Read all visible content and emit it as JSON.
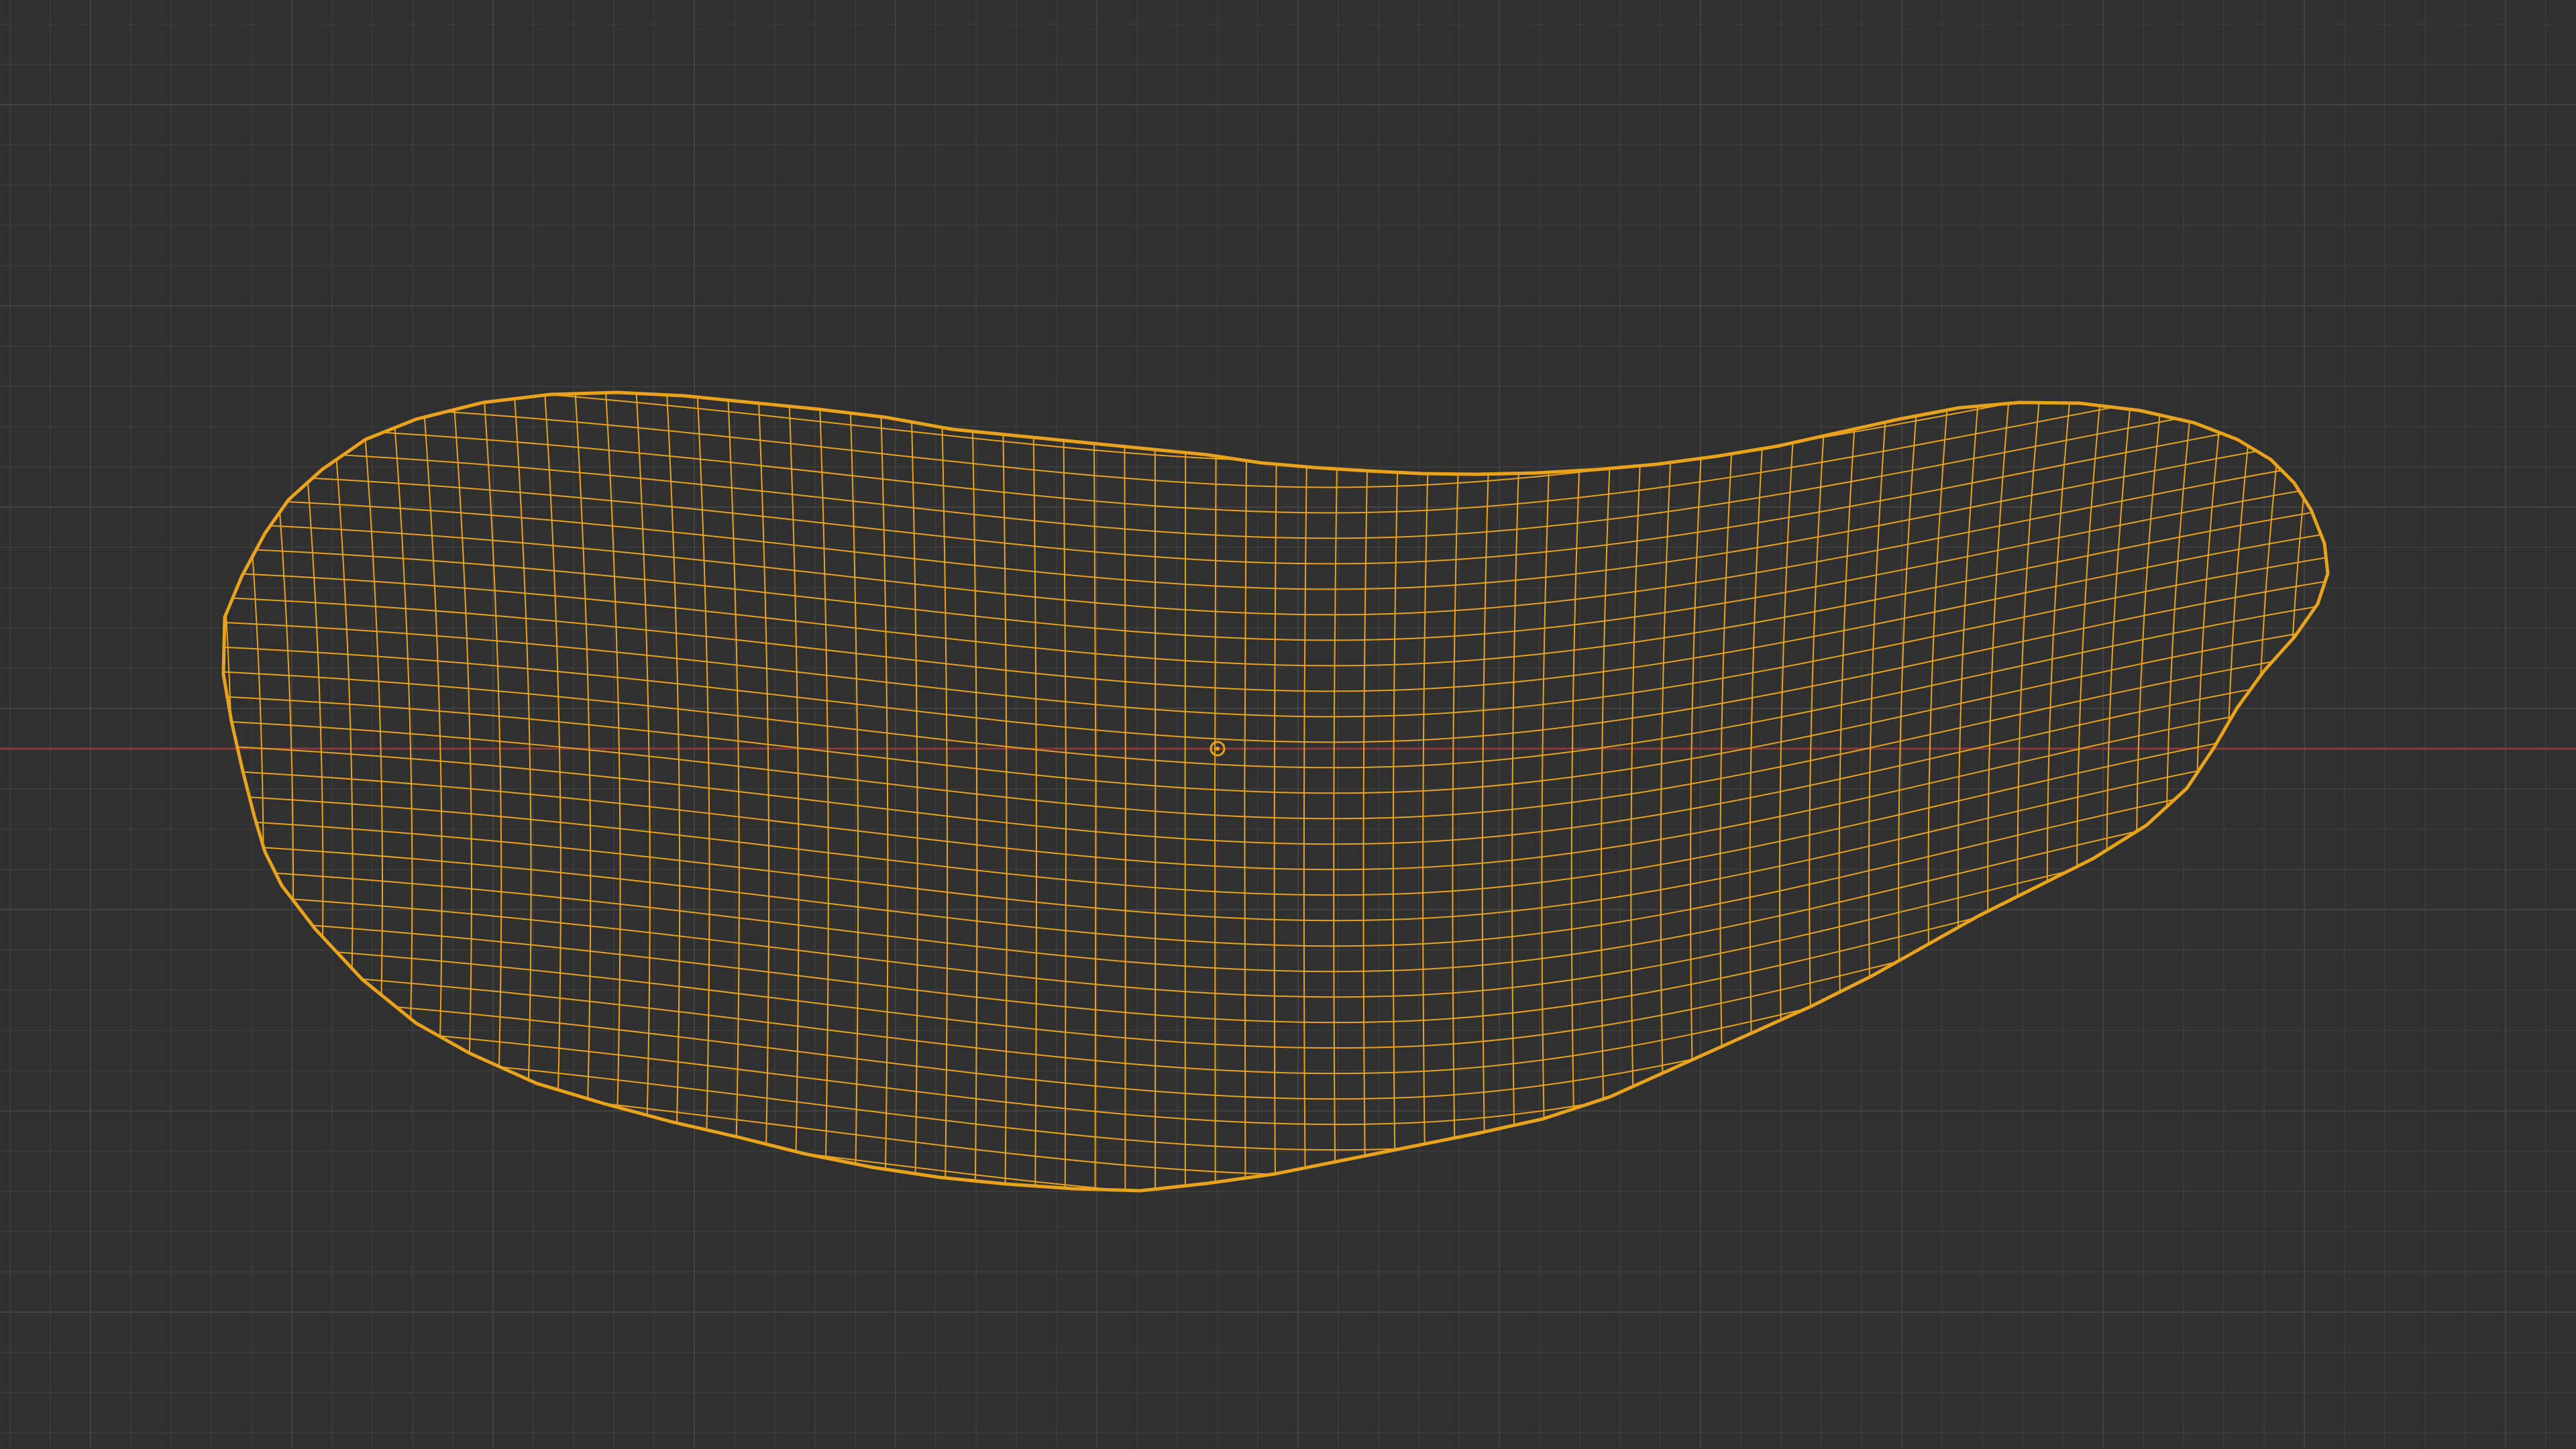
{
  "viewport": {
    "editor": "3d-viewport",
    "shading_mode": "wireframe",
    "object_selected": true,
    "colors": {
      "background": "#303030",
      "grid_minor": "#3a3a3a",
      "grid_major": "#424242",
      "x_axis": "#8a3a3e",
      "wireframe_selected": "#e8a21c",
      "origin_marker": "#e8a21c"
    },
    "icons": {
      "origin": "object-origin-icon",
      "mesh": "mesh-wireframe-icon"
    }
  }
}
